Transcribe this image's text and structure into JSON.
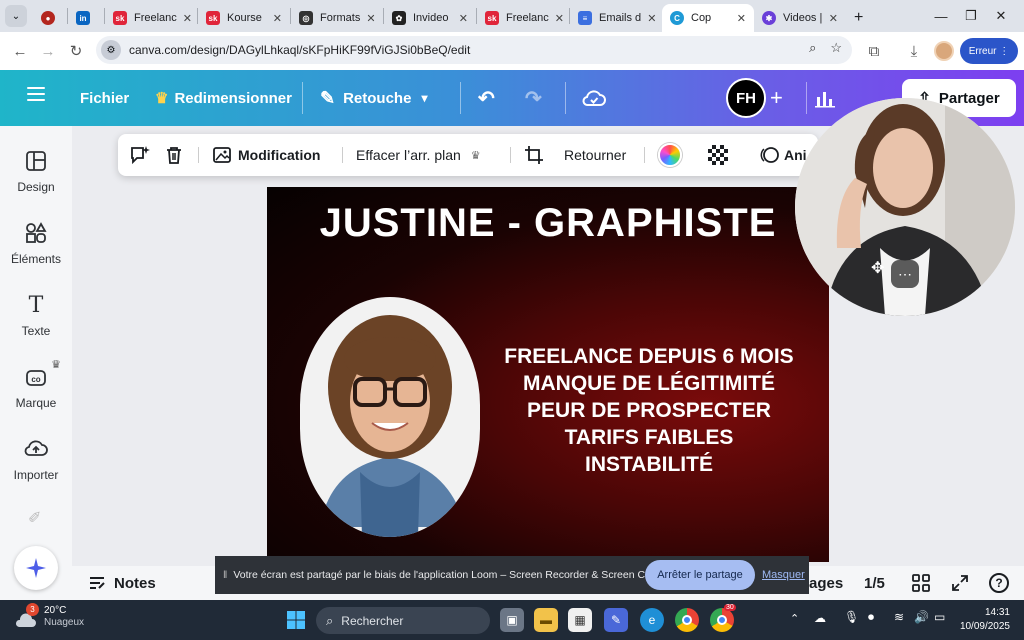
{
  "browser": {
    "tabs": [
      {
        "label": "",
        "icon": "record-icon",
        "color": "#b3261e"
      },
      {
        "label": "",
        "icon": "linkedin-icon",
        "color": "#0a66c2"
      },
      {
        "label": "Freelanc",
        "icon": "sk-icon",
        "color": "#e0253a"
      },
      {
        "label": "Kourse",
        "icon": "sk-icon",
        "color": "#e0253a"
      },
      {
        "label": "Formats",
        "icon": "chatgpt-icon",
        "color": "#333333"
      },
      {
        "label": "Invideo",
        "icon": "invideo-icon",
        "color": "#222222"
      },
      {
        "label": "Freelanc",
        "icon": "sk-icon",
        "color": "#e0253a"
      },
      {
        "label": "Emails d",
        "icon": "docs-icon",
        "color": "#3b6fe0"
      },
      {
        "label": "Cop",
        "icon": "canva-icon",
        "color": "#1f9ad6"
      },
      {
        "label": "Videos |",
        "icon": "gear-purple-icon",
        "color": "#6a3fd8"
      }
    ],
    "url": "canva.com/design/DAGylLhkaql/sKFpHiKF99fViGJSi0bBeQ/edit",
    "error_label": "Erreur"
  },
  "canva": {
    "header": {
      "file": "Fichier",
      "resize": "Redimensionner",
      "edit_mode": "Retouche",
      "avatar_initials": "FH",
      "share": "Partager"
    },
    "rail": [
      {
        "label": "Design",
        "icon": "design-icon"
      },
      {
        "label": "Éléments",
        "icon": "elements-icon"
      },
      {
        "label": "Texte",
        "icon": "text-icon"
      },
      {
        "label": "Marque",
        "icon": "brand-icon"
      },
      {
        "label": "Importer",
        "icon": "upload-icon"
      }
    ],
    "toolbar": {
      "modification": "Modification",
      "remove_bg": "Effacer l’arr. plan",
      "flip": "Retourner",
      "animate": "Ani"
    },
    "design": {
      "title": "JUSTINE - GRAPHISTE",
      "lines": [
        "FREELANCE DEPUIS 6 MOIS",
        "MANQUE DE LÉGITIMITÉ",
        "PEUR DE PROSPECTER",
        "TARIFS FAIBLES",
        "INSTABILITÉ"
      ]
    },
    "bottom": {
      "notes": "Notes",
      "pages_partial": "ages",
      "page_count": "1/5",
      "help": "?"
    }
  },
  "loom": {
    "banner_text": "Votre écran est partagé par le biais de l'application Loom – Screen Recorder & Screen Capture.",
    "stop": "Arrêter le partage",
    "hide": "Masquer"
  },
  "taskbar": {
    "temp": "20°C",
    "weather": "Nuageux",
    "weather_badge": "3",
    "search": "Rechercher",
    "time": "14:31",
    "date": "10/09/2025",
    "notif_badge": "30"
  }
}
